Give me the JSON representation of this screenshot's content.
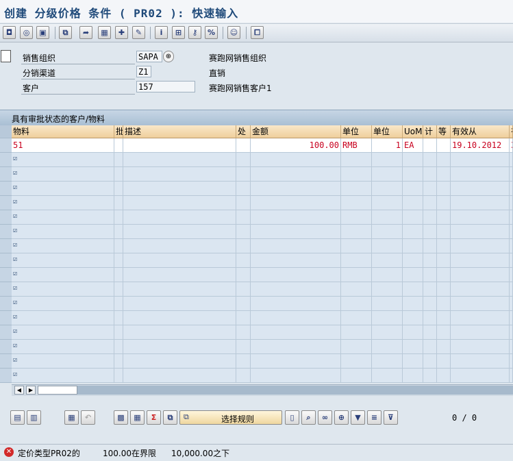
{
  "title": "创建 分级价格 条件 ( PR02 ): 快速输入",
  "toolbar": {
    "icons": [
      "sales-org-icon",
      "customer-icon",
      "variant-icon",
      "copy-icon",
      "export-icon",
      "calendar-icon",
      "gift-icon",
      "edit-icon",
      "info-icon",
      "structure-icon",
      "key-icon",
      "scale-icon",
      "person-icon",
      "new-window-icon"
    ]
  },
  "header": {
    "fields": [
      {
        "label": "销售组织",
        "value": "SAPA",
        "desc": "赛跑网销售组织"
      },
      {
        "label": "分销渠道",
        "value": "Z1",
        "desc": "直销"
      },
      {
        "label": "客户",
        "value": "157",
        "desc": "赛跑网销售客户1"
      }
    ]
  },
  "grid": {
    "title": "具有审批状态的客户/物料",
    "columns": [
      "物料",
      "批",
      "描述",
      "处",
      "金额",
      "单位",
      "单位",
      "UoM",
      "计",
      "等",
      "有效从",
      "有"
    ],
    "rows": [
      {
        "material": "51",
        "amount": "100.00",
        "unit": "RMB",
        "per": "1",
        "uom": "EA",
        "valid_from": "19.10.2012",
        "valid_to": "3"
      }
    ],
    "empty_rows": 16
  },
  "bottom_toolbar": {
    "select_rule_label": "选择规则",
    "pager": "0 / 0"
  },
  "status": {
    "message_parts": [
      "定价类型PR02的",
      "100.00在界限",
      "10,000.00之下"
    ]
  }
}
